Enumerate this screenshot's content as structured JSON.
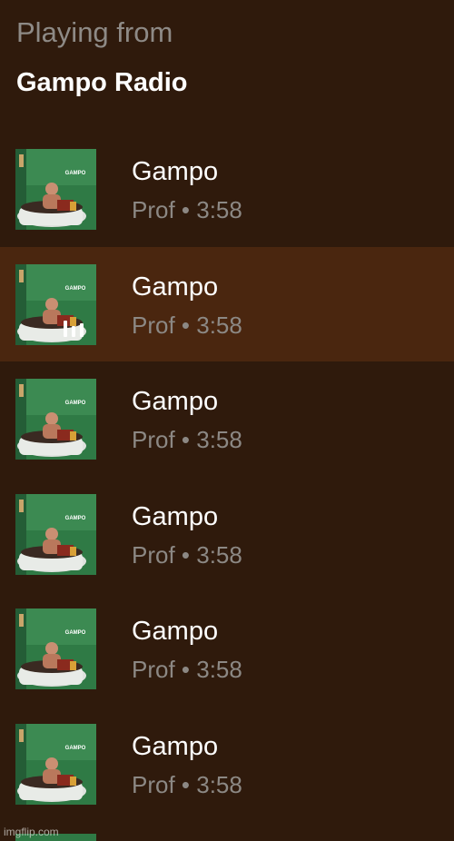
{
  "header": {
    "playing_from": "Playing from",
    "playlist_name": "Gampo Radio"
  },
  "queue": {
    "items": [
      {
        "title": "Gampo",
        "subtitle": "Prof • 3:58",
        "artwork": "album-art-gampo",
        "playing": false
      },
      {
        "title": "Gampo",
        "subtitle": "Prof • 3:58",
        "artwork": "album-art-gampo",
        "playing": true
      },
      {
        "title": "Gampo",
        "subtitle": "Prof • 3:58",
        "artwork": "album-art-gampo",
        "playing": false
      },
      {
        "title": "Gampo",
        "subtitle": "Prof • 3:58",
        "artwork": "album-art-gampo",
        "playing": false
      },
      {
        "title": "Gampo",
        "subtitle": "Prof • 3:58",
        "artwork": "album-art-gampo",
        "playing": false
      },
      {
        "title": "Gampo",
        "subtitle": "Prof • 3:58",
        "artwork": "album-art-gampo",
        "playing": false
      }
    ]
  },
  "colors": {
    "background": "#2f1a0c",
    "active_row": "#4a260f",
    "secondary_text": "#8c8884"
  },
  "icons": {
    "now_playing": "equalizer-bars-icon"
  },
  "watermark": "imgflip.com"
}
